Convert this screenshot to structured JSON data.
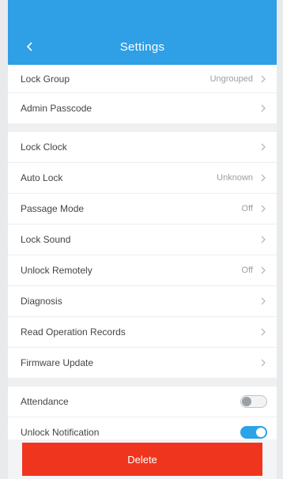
{
  "status": {
    "left": "",
    "right": ""
  },
  "nav": {
    "title": "Settings"
  },
  "group1": [
    {
      "label": "Lock Group",
      "value": "Ungrouped"
    },
    {
      "label": "Admin Passcode",
      "value": ""
    }
  ],
  "group2": [
    {
      "label": "Lock Clock",
      "value": ""
    },
    {
      "label": "Auto Lock",
      "value": "Unknown"
    },
    {
      "label": "Passage Mode",
      "value": "Off"
    },
    {
      "label": "Lock Sound",
      "value": ""
    },
    {
      "label": "Unlock Remotely",
      "value": "Off"
    },
    {
      "label": "Diagnosis",
      "value": ""
    },
    {
      "label": "Read Operation Records",
      "value": ""
    },
    {
      "label": "Firmware Update",
      "value": ""
    }
  ],
  "group3": [
    {
      "label": "Attendance",
      "toggle": false
    },
    {
      "label": "Unlock Notification",
      "toggle": true
    }
  ],
  "delete_label": "Delete",
  "colors": {
    "accent": "#2f9fe6",
    "danger": "#f0351f"
  }
}
